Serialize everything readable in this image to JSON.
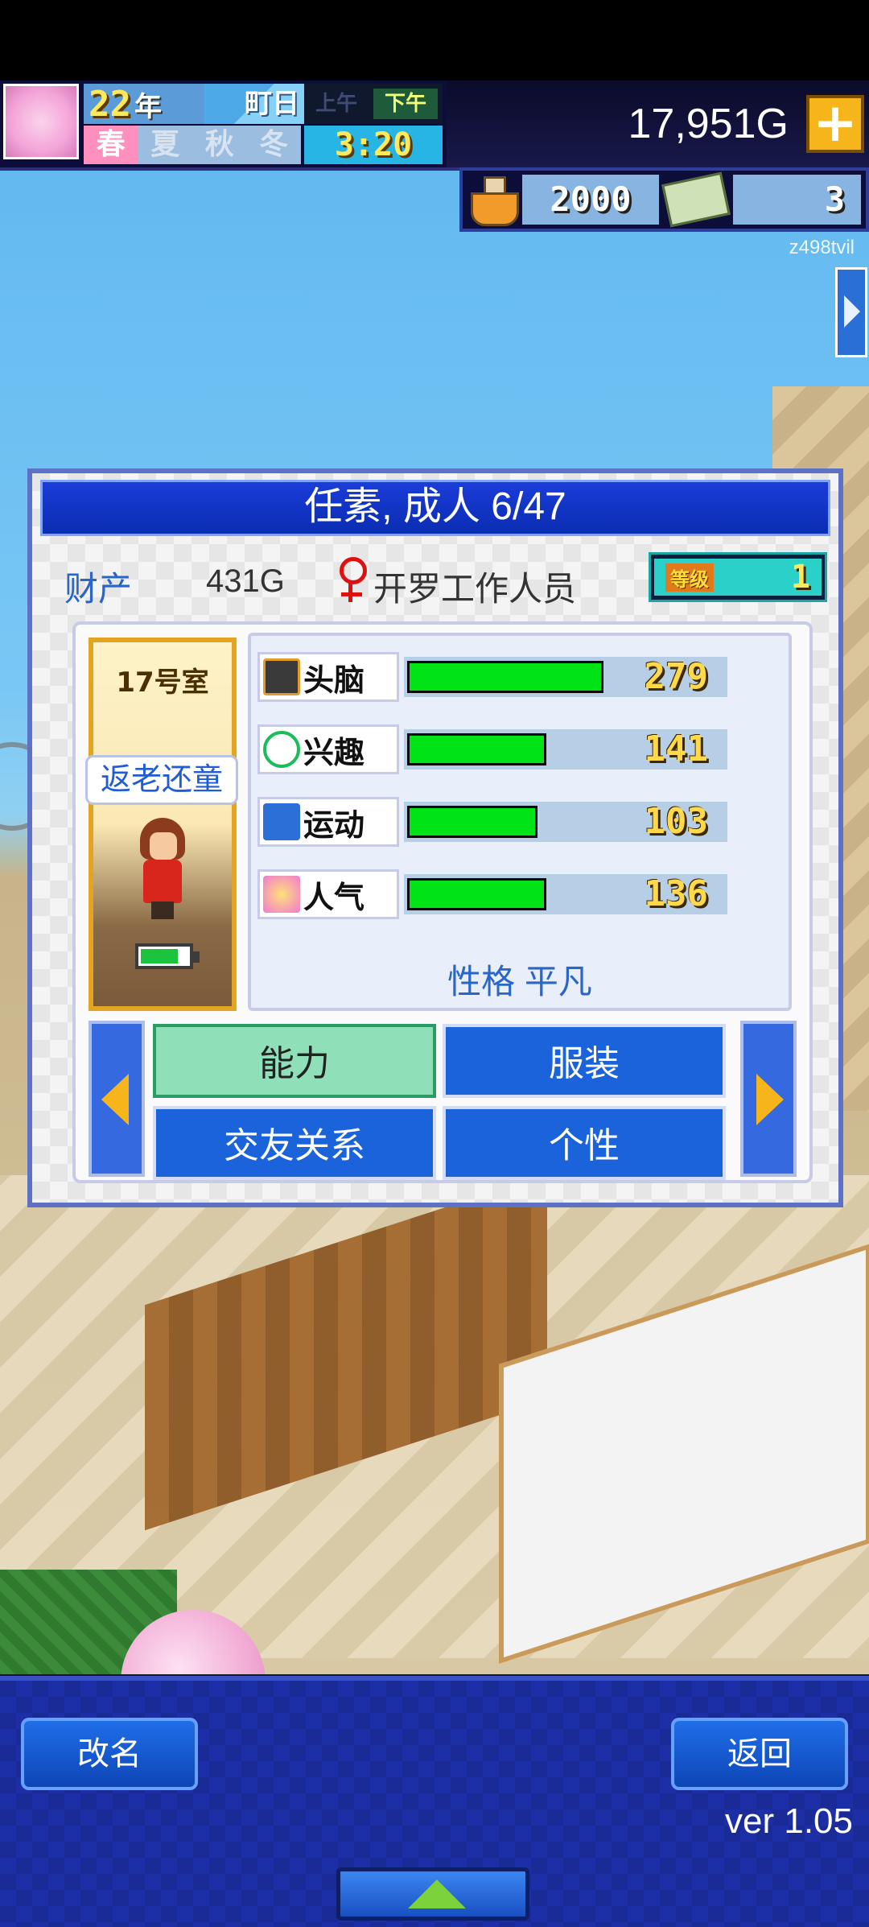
{
  "hud": {
    "year_number": "22",
    "year_unit": "年",
    "weekday": "町日",
    "am_label": "上午",
    "pm_label": "下午",
    "seasons": [
      "春",
      "夏",
      "秋",
      "冬"
    ],
    "time": "3:20",
    "money": "17,951G",
    "research_points": "2000",
    "tickets": "3",
    "user_id": "z498tvil"
  },
  "dialog": {
    "title": "任素, 成人 6/47",
    "asset_label": "财产",
    "asset_value": "431G",
    "job": "开罗工作人员",
    "level_label": "等级",
    "level_value": "1",
    "room": "17号室",
    "rejuvenate_button": "返老还童",
    "stats": [
      {
        "name": "头脑",
        "value": "279",
        "fraction": 0.62
      },
      {
        "name": "兴趣",
        "value": "141",
        "fraction": 0.44
      },
      {
        "name": "运动",
        "value": "103",
        "fraction": 0.41
      },
      {
        "name": "人气",
        "value": "136",
        "fraction": 0.44
      }
    ],
    "personality": "性格 平凡",
    "tabs": [
      "能力",
      "服装",
      "交友关系",
      "个性"
    ]
  },
  "bottom": {
    "rename_button": "改名",
    "back_button": "返回",
    "version": "ver 1.05"
  },
  "colors": {
    "accent": "#1a63db",
    "active_tab": "#8fdfb8",
    "stat_fill": "#00e316"
  }
}
